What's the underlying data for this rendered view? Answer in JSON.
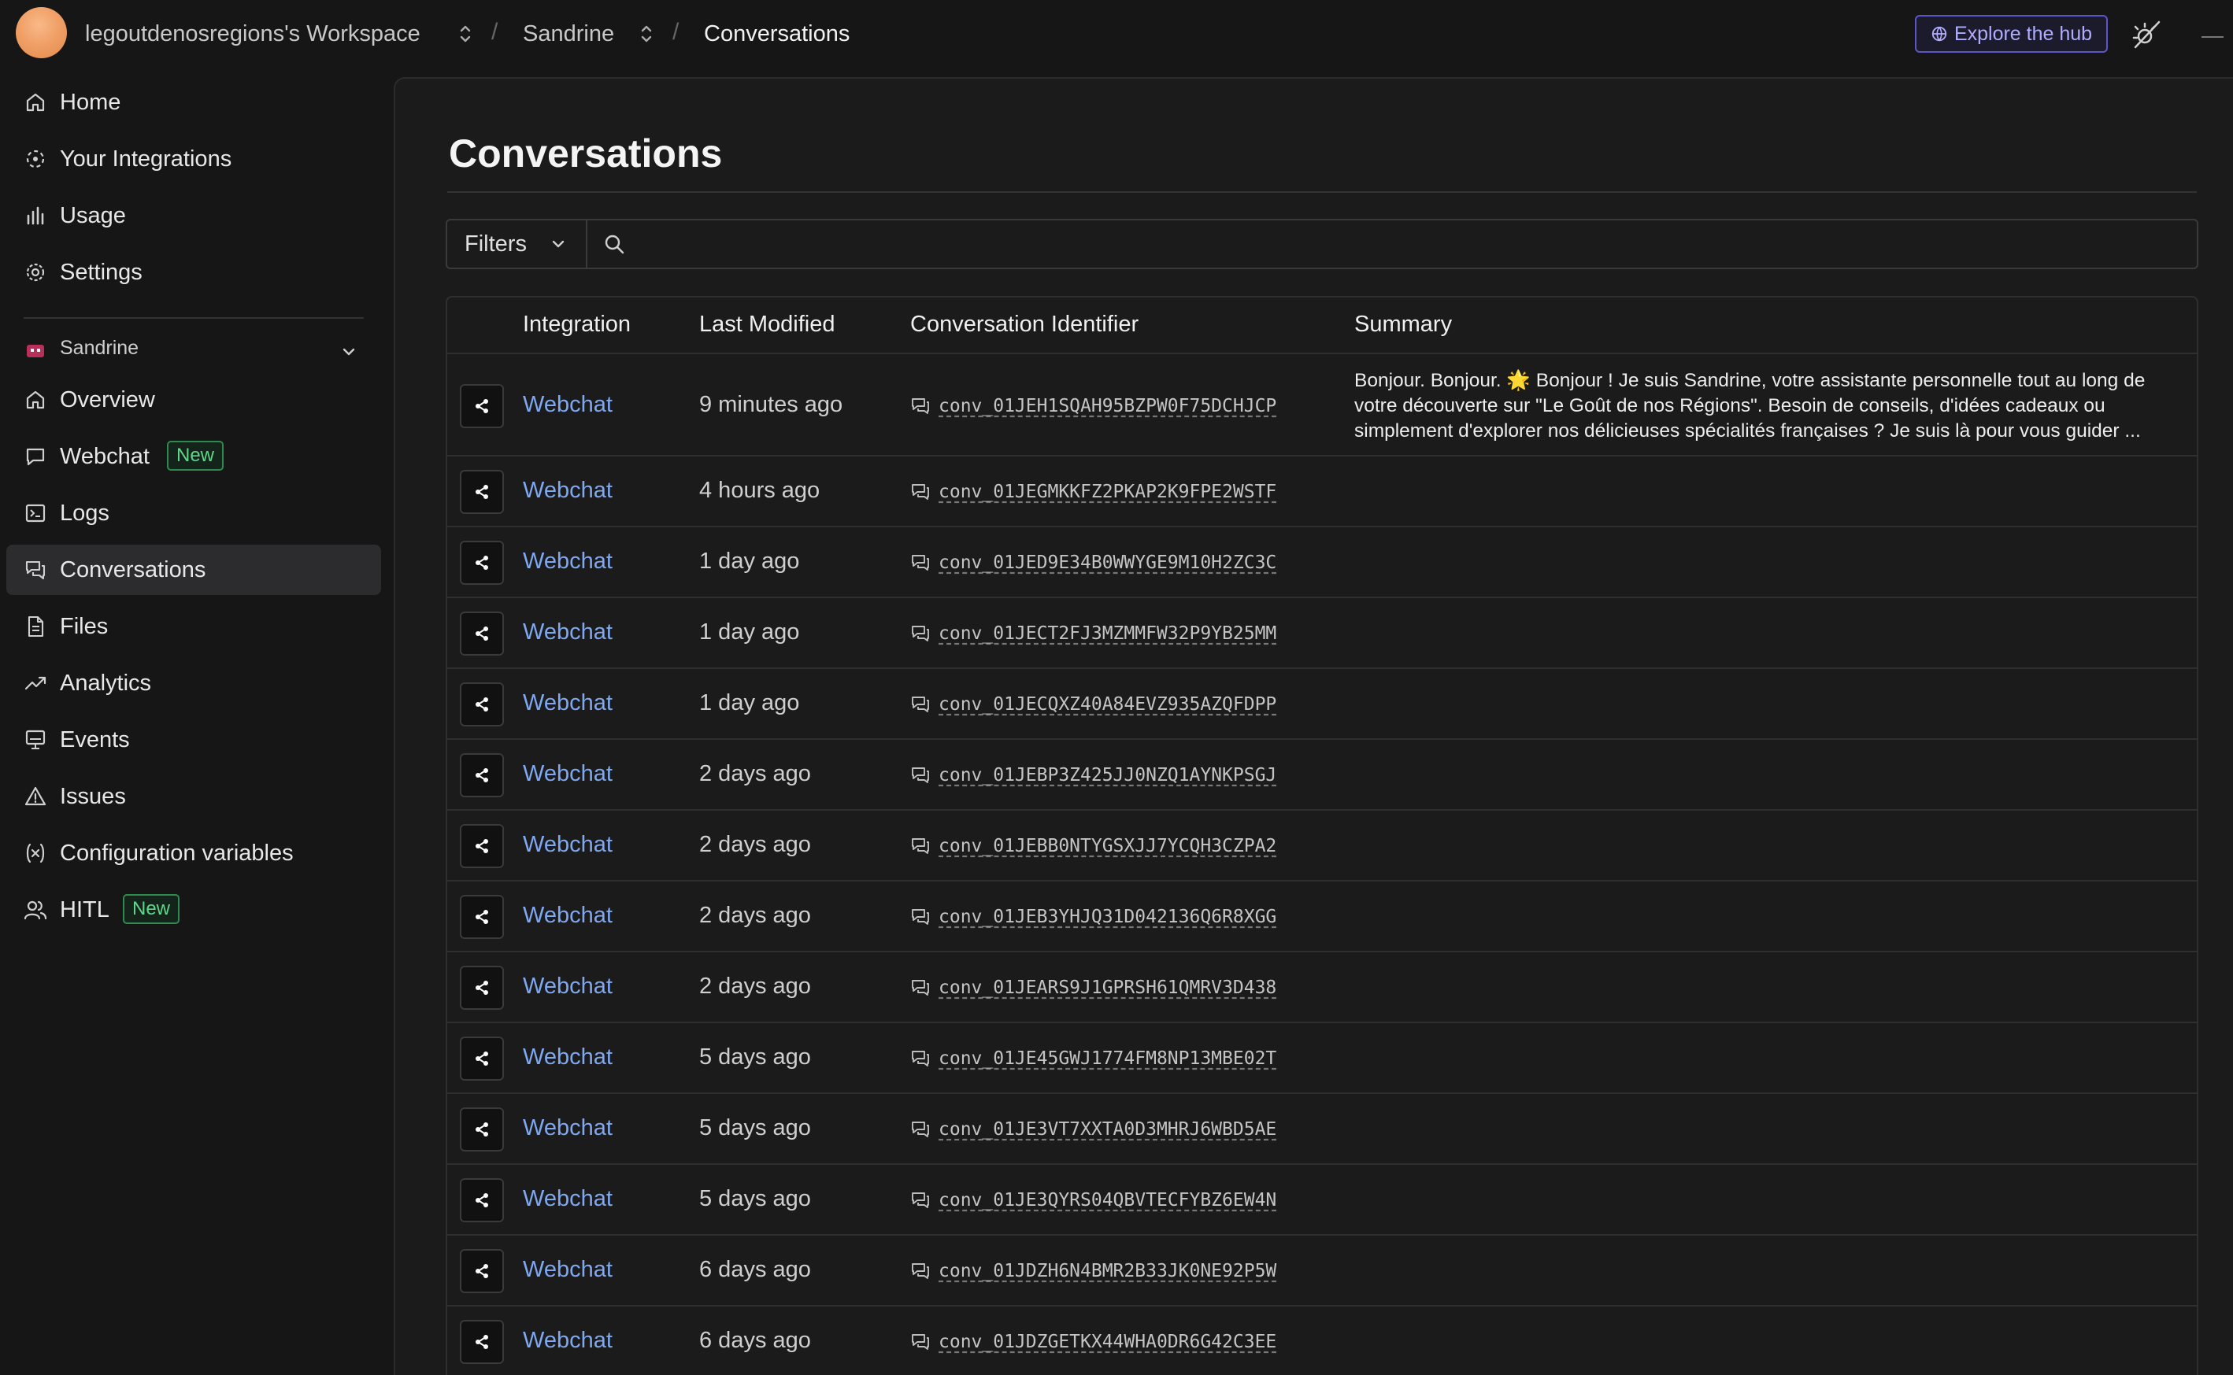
{
  "topbar": {
    "workspace": "legoutdenosregions's Workspace",
    "bot": "Sandrine",
    "page": "Conversations",
    "explore_label": "Explore the hub",
    "separator": "/"
  },
  "sidebar": {
    "top_items": [
      {
        "label": "Home",
        "icon": "home-icon"
      },
      {
        "label": "Your Integrations",
        "icon": "integrations-icon"
      },
      {
        "label": "Usage",
        "icon": "bar-chart-icon"
      },
      {
        "label": "Settings",
        "icon": "gear-icon"
      }
    ],
    "bot_name": "Sandrine",
    "bot_items": [
      {
        "label": "Overview",
        "icon": "home-icon"
      },
      {
        "label": "Webchat",
        "icon": "chat-bubble-icon",
        "badge": "New"
      },
      {
        "label": "Logs",
        "icon": "terminal-icon"
      },
      {
        "label": "Conversations",
        "icon": "conversations-icon",
        "active": true
      },
      {
        "label": "Files",
        "icon": "file-icon"
      },
      {
        "label": "Analytics",
        "icon": "trend-icon"
      },
      {
        "label": "Events",
        "icon": "monitor-icon"
      },
      {
        "label": "Issues",
        "icon": "warning-icon"
      },
      {
        "label": "Configuration variables",
        "icon": "variable-icon"
      },
      {
        "label": "HITL",
        "icon": "users-icon",
        "badge": "New"
      }
    ]
  },
  "main": {
    "title": "Conversations",
    "filters_label": "Filters",
    "search_placeholder": "",
    "columns": [
      "Integration",
      "Last Modified",
      "Conversation Identifier",
      "Summary"
    ],
    "rows": [
      {
        "integration": "Webchat",
        "modified": "9 minutes ago",
        "id": "conv_01JEH1SQAH95BZPW0F75DCHJCP",
        "summary": "Bonjour. Bonjour. 🌟 Bonjour ! Je suis Sandrine, votre assistante personnelle tout au long de votre découverte sur \"Le Goût de nos Régions\". Besoin de conseils, d'idées cadeaux ou simplement d'explorer nos délicieuses spécialités françaises ? Je suis là pour vous guider ..."
      },
      {
        "integration": "Webchat",
        "modified": "4 hours ago",
        "id": "conv_01JEGMKKFZ2PKAP2K9FPE2WSTF",
        "summary": ""
      },
      {
        "integration": "Webchat",
        "modified": "1 day ago",
        "id": "conv_01JED9E34B0WWYGE9M10H2ZC3C",
        "summary": ""
      },
      {
        "integration": "Webchat",
        "modified": "1 day ago",
        "id": "conv_01JECT2FJ3MZMMFW32P9YB25MM",
        "summary": ""
      },
      {
        "integration": "Webchat",
        "modified": "1 day ago",
        "id": "conv_01JECQXZ40A84EVZ935AZQFDPP",
        "summary": ""
      },
      {
        "integration": "Webchat",
        "modified": "2 days ago",
        "id": "conv_01JEBP3Z425JJ0NZQ1AYNKPSGJ",
        "summary": ""
      },
      {
        "integration": "Webchat",
        "modified": "2 days ago",
        "id": "conv_01JEBB0NTYGSXJJ7YCQH3CZPA2",
        "summary": ""
      },
      {
        "integration": "Webchat",
        "modified": "2 days ago",
        "id": "conv_01JEB3YHJQ31D042136Q6R8XGG",
        "summary": ""
      },
      {
        "integration": "Webchat",
        "modified": "2 days ago",
        "id": "conv_01JEARS9J1GPRSH61QMRV3D438",
        "summary": ""
      },
      {
        "integration": "Webchat",
        "modified": "5 days ago",
        "id": "conv_01JE45GWJ1774FM8NP13MBE02T",
        "summary": ""
      },
      {
        "integration": "Webchat",
        "modified": "5 days ago",
        "id": "conv_01JE3VT7XXTA0D3MHRJ6WBD5AE",
        "summary": ""
      },
      {
        "integration": "Webchat",
        "modified": "5 days ago",
        "id": "conv_01JE3QYRS04QBVTECFYBZ6EW4N",
        "summary": ""
      },
      {
        "integration": "Webchat",
        "modified": "6 days ago",
        "id": "conv_01JDZH6N4BMR2B33JK0NE92P5W",
        "summary": ""
      },
      {
        "integration": "Webchat",
        "modified": "6 days ago",
        "id": "conv_01JDZGETKX44WHA0DR6G42C3EE",
        "summary": ""
      }
    ]
  },
  "colors": {
    "accent": "#7fa8f0",
    "badge_green": "#5fd68a",
    "hub_purple": "#b0adff",
    "background": "#161616"
  }
}
